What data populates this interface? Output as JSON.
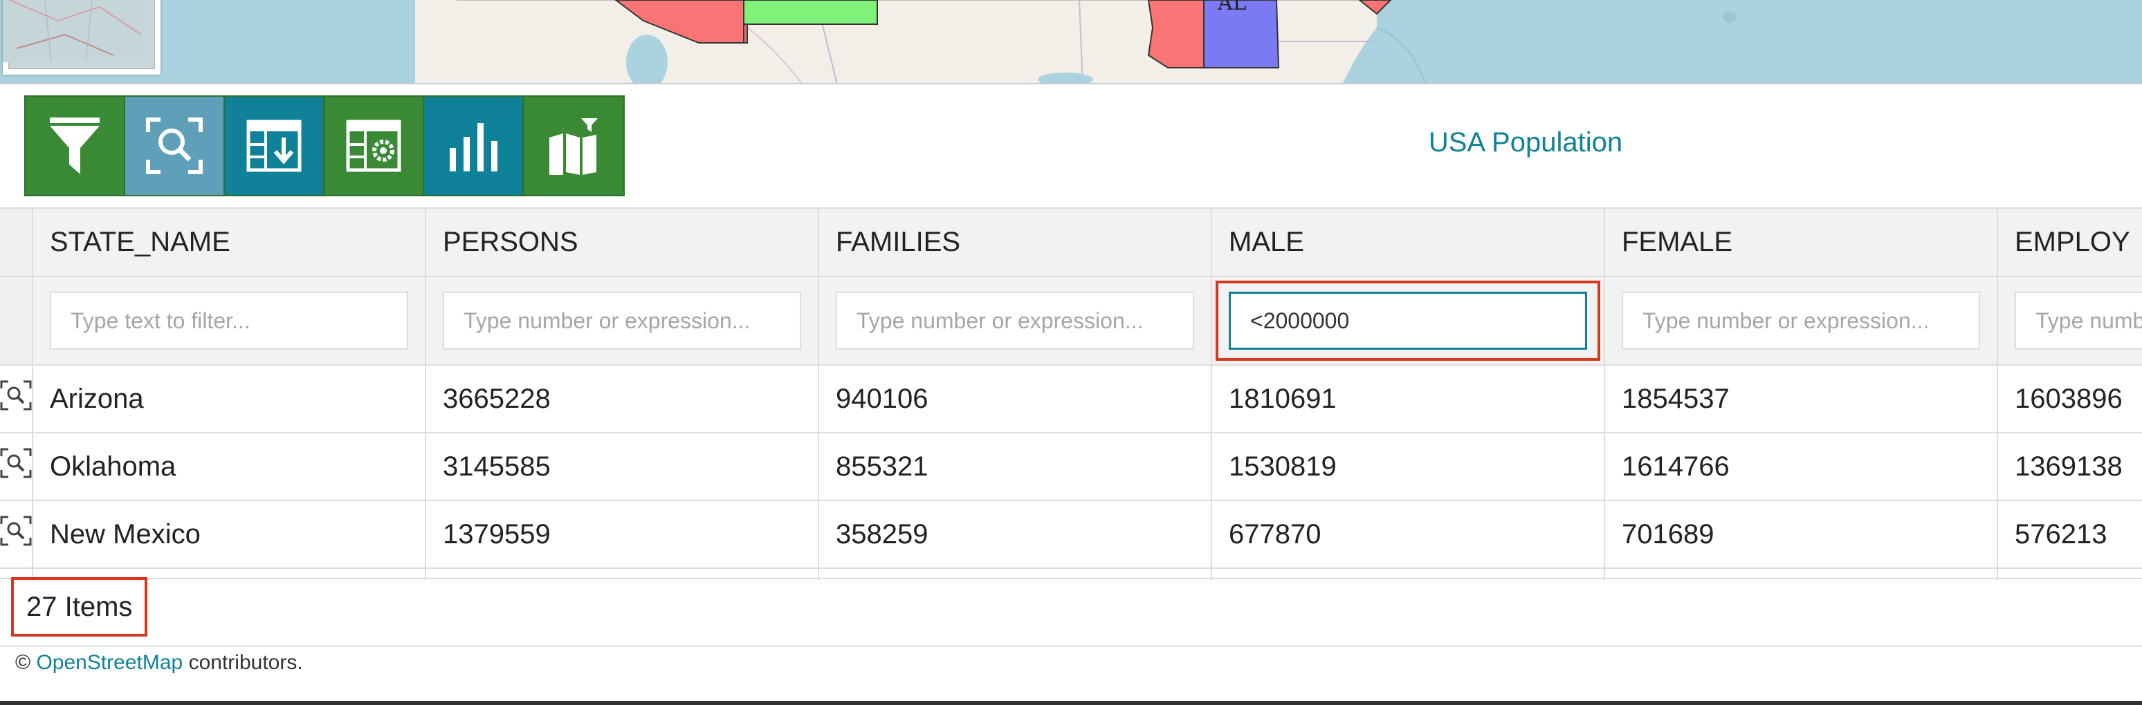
{
  "map": {
    "state_label": "AL"
  },
  "toolbar": {
    "buttons": [
      {
        "name": "filter",
        "icon": "filter-icon",
        "color": "#3a8a35"
      },
      {
        "name": "zoom-to-selection",
        "icon": "zoom-extent-icon",
        "color": "#5fa0b8"
      },
      {
        "name": "export-table",
        "icon": "table-download-icon",
        "color": "#0f8199"
      },
      {
        "name": "table-settings",
        "icon": "table-gear-icon",
        "color": "#3a8a35"
      },
      {
        "name": "chart",
        "icon": "bar-chart-icon",
        "color": "#0f8199"
      },
      {
        "name": "map-filter",
        "icon": "map-filter-icon",
        "color": "#3a8a35"
      }
    ],
    "layer_title": "USA Population"
  },
  "grid": {
    "columns": [
      "STATE_NAME",
      "PERSONS",
      "FAMILIES",
      "MALE",
      "FEMALE",
      "EMPLOY"
    ],
    "filters": [
      {
        "placeholder": "Type text to filter...",
        "value": ""
      },
      {
        "placeholder": "Type number or expression...",
        "value": ""
      },
      {
        "placeholder": "Type number or expression...",
        "value": ""
      },
      {
        "placeholder": "Type number or expression...",
        "value": "<2000000"
      },
      {
        "placeholder": "Type number or expression...",
        "value": ""
      },
      {
        "placeholder": "Type number or expression...",
        "value": ""
      }
    ],
    "rows": [
      [
        "Arizona",
        "3665228",
        "940106",
        "1810691",
        "1854537",
        "1603896"
      ],
      [
        "Oklahoma",
        "3145585",
        "855321",
        "1530819",
        "1614766",
        "1369138"
      ],
      [
        "New Mexico",
        "1379559",
        "358259",
        "677870",
        "701689",
        "576213"
      ]
    ]
  },
  "footer": {
    "item_count": "27 Items",
    "attribution_prefix": "©",
    "attribution_link": "OpenStreetMap",
    "attribution_suffix": "contributors."
  },
  "colors": {
    "accent": "#0f8199",
    "green": "#3a8a35",
    "highlight": "#d4391f"
  }
}
